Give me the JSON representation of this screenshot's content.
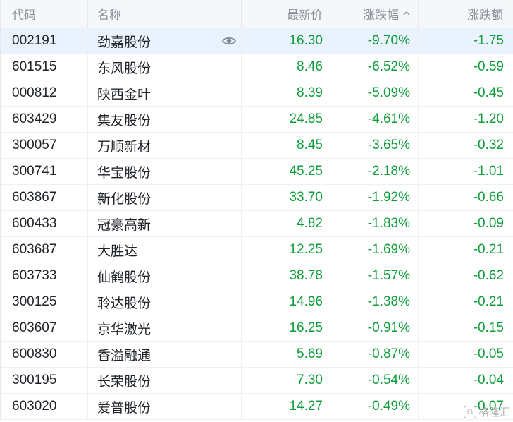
{
  "table": {
    "columns": {
      "code": "代码",
      "name": "名称",
      "price": "最新价",
      "pct": "涨跌幅",
      "chg": "涨跌额"
    },
    "sort_icon": "caret-up-icon",
    "row_icon": "eye-icon",
    "color_down": "#0f9d3a",
    "rows": [
      {
        "code": "002191",
        "name": "劲嘉股份",
        "price": "16.30",
        "pct": "-9.70%",
        "chg": "-1.75"
      },
      {
        "code": "601515",
        "name": "东风股份",
        "price": "8.46",
        "pct": "-6.52%",
        "chg": "-0.59"
      },
      {
        "code": "000812",
        "name": "陕西金叶",
        "price": "8.39",
        "pct": "-5.09%",
        "chg": "-0.45"
      },
      {
        "code": "603429",
        "name": "集友股份",
        "price": "24.85",
        "pct": "-4.61%",
        "chg": "-1.20"
      },
      {
        "code": "300057",
        "name": "万顺新材",
        "price": "8.45",
        "pct": "-3.65%",
        "chg": "-0.32"
      },
      {
        "code": "300741",
        "name": "华宝股份",
        "price": "45.25",
        "pct": "-2.18%",
        "chg": "-1.01"
      },
      {
        "code": "603867",
        "name": "新化股份",
        "price": "33.70",
        "pct": "-1.92%",
        "chg": "-0.66"
      },
      {
        "code": "600433",
        "name": "冠豪高新",
        "price": "4.82",
        "pct": "-1.83%",
        "chg": "-0.09"
      },
      {
        "code": "603687",
        "name": "大胜达",
        "price": "12.25",
        "pct": "-1.69%",
        "chg": "-0.21"
      },
      {
        "code": "603733",
        "name": "仙鹤股份",
        "price": "38.78",
        "pct": "-1.57%",
        "chg": "-0.62"
      },
      {
        "code": "300125",
        "name": "聆达股份",
        "price": "14.96",
        "pct": "-1.38%",
        "chg": "-0.21"
      },
      {
        "code": "603607",
        "name": "京华激光",
        "price": "16.25",
        "pct": "-0.91%",
        "chg": "-0.15"
      },
      {
        "code": "600830",
        "name": "香溢融通",
        "price": "5.69",
        "pct": "-0.87%",
        "chg": "-0.05"
      },
      {
        "code": "300195",
        "name": "长荣股份",
        "price": "7.30",
        "pct": "-0.54%",
        "chg": "-0.04"
      },
      {
        "code": "603020",
        "name": "爱普股份",
        "price": "14.27",
        "pct": "-0.49%",
        "chg": "-0.07"
      }
    ]
  },
  "watermark": {
    "logo": "G",
    "text": "格隆汇"
  }
}
